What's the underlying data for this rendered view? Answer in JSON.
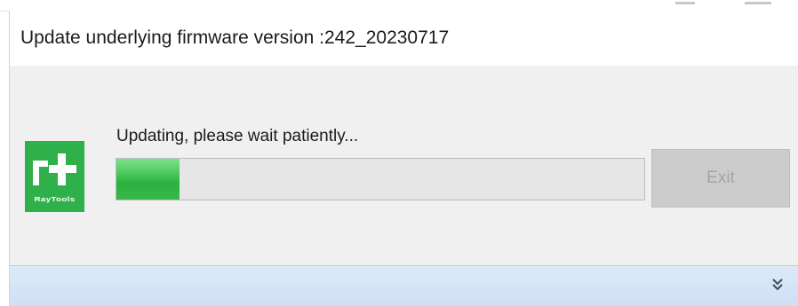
{
  "dialog": {
    "title": "Update underlying firmware version :242_20230717",
    "status_text": "Updating, please wait patiently...",
    "progress": 0.12,
    "exit_label": "Exit",
    "exit_enabled": false
  },
  "logo": {
    "brand_text": "RayTools",
    "icon": "raytools-logo-icon"
  },
  "footer": {
    "icon": "double-chevron-down-icon"
  },
  "colors": {
    "brand": "#2fb04a",
    "progress_fill": "#3cbf4f",
    "footer_bg": "#d6e4f5",
    "dialog_bg": "#f0f0f0"
  }
}
